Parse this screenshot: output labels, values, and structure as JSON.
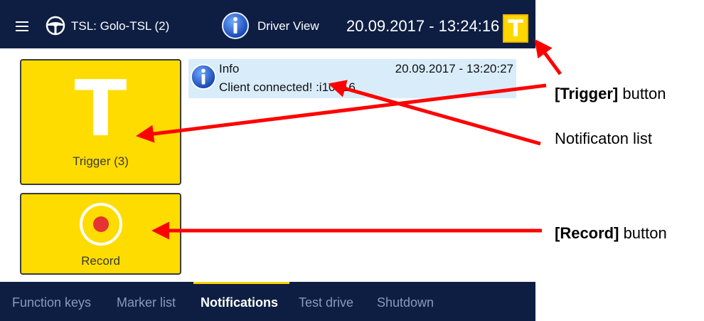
{
  "topbar": {
    "menu_icon": "menu-icon",
    "tsl_icon": "steering-wheel-icon",
    "tsl_label": "TSL: Golo-TSL (2)",
    "driver_icon": "info-icon",
    "driver_view_label": "Driver View",
    "datetime": "20.09.2017 - 13:24:16",
    "trigger_letter": "T"
  },
  "buttons": {
    "trigger": {
      "letter": "T",
      "label": "Trigger (3)"
    },
    "record": {
      "label": "Record"
    }
  },
  "notifications": [
    {
      "type": "Info",
      "time": "20.09.2017 - 13:20:27",
      "message": "Client connected! :i10816"
    }
  ],
  "tabs": [
    {
      "label": "Function keys",
      "active": false
    },
    {
      "label": "Marker list",
      "active": false
    },
    {
      "label": "Notifications",
      "active": true
    },
    {
      "label": "Test drive",
      "active": false
    },
    {
      "label": "Shutdown",
      "active": false
    }
  ],
  "callouts": {
    "trigger_bold": "[Trigger]",
    "trigger_rest": " button",
    "notifications": "Notificaton list",
    "record_bold": "[Record]",
    "record_rest": " button"
  },
  "colors": {
    "bar_bg": "#0e1e43",
    "button_yellow": "#ffdc00",
    "record_red": "#e63232",
    "notif_bg": "#d9ecfa",
    "arrow_red": "#ff0000"
  }
}
